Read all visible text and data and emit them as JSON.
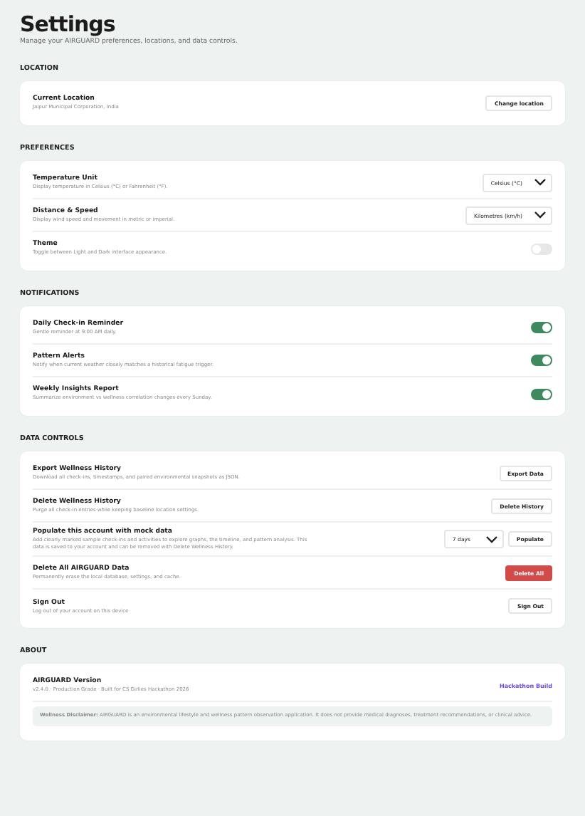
{
  "header": {
    "title": "Settings",
    "subtitle": "Manage your AIRGUARD preferences, locations, and data controls."
  },
  "sections": [
    {
      "title": "LOCATION",
      "rows": [
        {
          "title": "Current Location",
          "description": "Jaipur Municipal Corporation, India",
          "controls": [
            {
              "kind": "button",
              "label": "Change location"
            }
          ]
        }
      ]
    },
    {
      "title": "PREFERENCES",
      "rows": [
        {
          "title": "Temperature Unit",
          "description": "Display temperature in Celsius (°C) or Fahrenheit (°F).",
          "controls": [
            {
              "kind": "select",
              "value": "Celsius (°C)"
            }
          ]
        },
        {
          "title": "Distance & Speed",
          "description": "Display wind speed and movement in metric or imperial.",
          "controls": [
            {
              "kind": "select",
              "value": "Kilometres (km/h)"
            }
          ]
        },
        {
          "title": "Theme",
          "description": "Toggle between Light and Dark interface appearance.",
          "controls": [
            {
              "kind": "toggle",
              "on": false
            }
          ]
        }
      ]
    },
    {
      "title": "NOTIFICATIONS",
      "rows": [
        {
          "title": "Daily Check-in Reminder",
          "description": "Gentle reminder at 9:00 AM daily.",
          "controls": [
            {
              "kind": "toggle",
              "on": true
            }
          ]
        },
        {
          "title": "Pattern Alerts",
          "description": "Notify when current weather closely matches a historical fatigue trigger.",
          "controls": [
            {
              "kind": "toggle",
              "on": true
            }
          ]
        },
        {
          "title": "Weekly Insights Report",
          "description": "Summarize environment vs wellness correlation changes every Sunday.",
          "controls": [
            {
              "kind": "toggle",
              "on": true
            }
          ]
        }
      ]
    },
    {
      "title": "DATA CONTROLS",
      "rows": [
        {
          "title": "Export Wellness History",
          "description": "Download all check-ins, timestamps, and paired environmental snapshots as JSON.",
          "controls": [
            {
              "kind": "button",
              "label": "Export Data"
            }
          ]
        },
        {
          "title": "Delete Wellness History",
          "description": "Purge all check-in entries while keeping baseline location settings.",
          "controls": [
            {
              "kind": "button",
              "label": "Delete History"
            }
          ]
        },
        {
          "title": "Populate this account with mock data",
          "description": "Add clearly marked sample check-ins and activities to explore graphs, the timeline, and pattern analysis. This data is saved to your account and can be removed with Delete Wellness History.",
          "controls": [
            {
              "kind": "select",
              "value": "7 days"
            },
            {
              "kind": "button",
              "label": "Populate"
            }
          ]
        },
        {
          "title": "Delete All AIRGUARD Data",
          "description": "Permanently erase the local database, settings, and cache.",
          "controls": [
            {
              "kind": "danger",
              "label": "Delete All"
            }
          ]
        },
        {
          "title": "Sign Out",
          "description": "Log out of your account on this device",
          "controls": [
            {
              "kind": "button",
              "label": "Sign Out"
            }
          ]
        }
      ]
    },
    {
      "title": "ABOUT",
      "rows": [
        {
          "title": "AIRGUARD Version",
          "description": "v2.4.0 · Production Grade · Built for CS Girlies Hackathon 2026",
          "controls": [
            {
              "kind": "link",
              "label": "Hackathon Build"
            }
          ]
        }
      ],
      "note": "**Wellness Disclaimer:** AIRGUARD is an environmental lifestyle and wellness pattern observation application. It does not provide medical diagnoses, treatment recommendations, or clinical advice."
    }
  ]
}
